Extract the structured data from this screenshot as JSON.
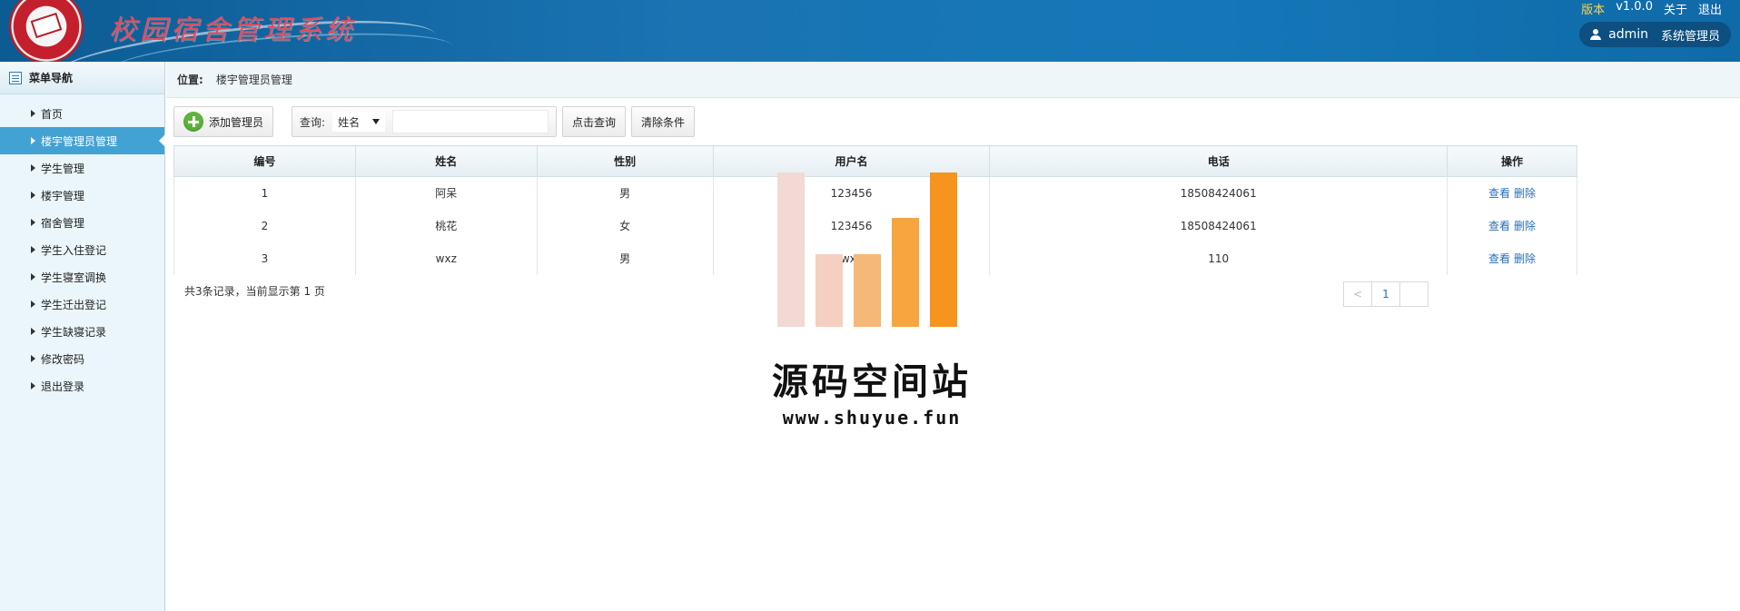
{
  "header": {
    "app_title": "校园宿舍管理系统",
    "version_label": "版本",
    "version": "v1.0.0",
    "about": "关于",
    "logout": "退出",
    "username": "admin",
    "role": "系统管理员"
  },
  "sidebar": {
    "title": "菜单导航",
    "items": [
      {
        "label": "首页"
      },
      {
        "label": "楼宇管理员管理"
      },
      {
        "label": "学生管理"
      },
      {
        "label": "楼宇管理"
      },
      {
        "label": "宿舍管理"
      },
      {
        "label": "学生入住登记"
      },
      {
        "label": "学生寝室调换"
      },
      {
        "label": "学生迁出登记"
      },
      {
        "label": "学生缺寝记录"
      },
      {
        "label": "修改密码"
      },
      {
        "label": "退出登录"
      }
    ],
    "active_index": 1
  },
  "breadcrumb": {
    "label": "位置:",
    "current": "楼宇管理员管理"
  },
  "toolbar": {
    "add_label": "添加管理员",
    "query_label": "查询:",
    "field_selected": "姓名",
    "search_value": "",
    "search_button": "点击查询",
    "clear_button": "清除条件"
  },
  "table": {
    "headers": [
      "编号",
      "姓名",
      "性别",
      "用户名",
      "电话",
      "操作"
    ],
    "rows": [
      {
        "id": "1",
        "name": "阿呆",
        "gender": "男",
        "username": "123456",
        "phone": "18508424061"
      },
      {
        "id": "2",
        "name": "桃花",
        "gender": "女",
        "username": "123456",
        "phone": "18508424061"
      },
      {
        "id": "3",
        "name": "wxz",
        "gender": "男",
        "username": "wxz",
        "phone": "110"
      }
    ],
    "view_label": "查看",
    "delete_label": "删除"
  },
  "footer": {
    "summary": "共3条记录，当前显示第 1 页"
  },
  "pager": {
    "prev": "<",
    "current_page": "1",
    "next": ""
  },
  "watermark": {
    "title": "源码空间站",
    "url": "www.shuyue.fun"
  },
  "colors": {
    "header_bg": "#1577b8",
    "sidebar_active": "#43a2d4",
    "link": "#2a6fb6",
    "add_icon": "#5cb53c",
    "watermark_orange": "#f7941d"
  }
}
